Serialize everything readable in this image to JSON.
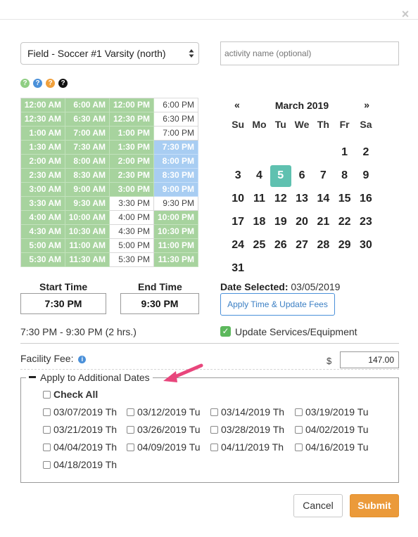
{
  "dialog": {
    "close_glyph": "×",
    "close_icon": "close-icon"
  },
  "form": {
    "facility_value": "Field - Soccer #1 Varsity (north)",
    "activity_placeholder": "activity name (optional)",
    "activity_value": ""
  },
  "help_icons": [
    {
      "name": "help-icon-green",
      "glyph": "?",
      "color": "#8fce83"
    },
    {
      "name": "help-icon-blue",
      "glyph": "?",
      "color": "#4a90d9"
    },
    {
      "name": "help-icon-orange",
      "glyph": "?",
      "color": "#f0a03c"
    },
    {
      "name": "help-icon-black",
      "glyph": "?",
      "color": "#111111"
    }
  ],
  "time_slots": {
    "columns": [
      [
        {
          "t": "12:00 AM",
          "s": "booked"
        },
        {
          "t": "12:30 AM",
          "s": "booked"
        },
        {
          "t": "1:00 AM",
          "s": "booked"
        },
        {
          "t": "1:30 AM",
          "s": "booked"
        },
        {
          "t": "2:00 AM",
          "s": "booked"
        },
        {
          "t": "2:30 AM",
          "s": "booked"
        },
        {
          "t": "3:00 AM",
          "s": "booked"
        },
        {
          "t": "3:30 AM",
          "s": "booked"
        },
        {
          "t": "4:00 AM",
          "s": "booked"
        },
        {
          "t": "4:30 AM",
          "s": "booked"
        },
        {
          "t": "5:00 AM",
          "s": "booked"
        },
        {
          "t": "5:30 AM",
          "s": "booked"
        }
      ],
      [
        {
          "t": "6:00 AM",
          "s": "booked"
        },
        {
          "t": "6:30 AM",
          "s": "booked"
        },
        {
          "t": "7:00 AM",
          "s": "booked"
        },
        {
          "t": "7:30 AM",
          "s": "booked"
        },
        {
          "t": "8:00 AM",
          "s": "booked"
        },
        {
          "t": "8:30 AM",
          "s": "booked"
        },
        {
          "t": "9:00 AM",
          "s": "booked"
        },
        {
          "t": "9:30 AM",
          "s": "booked"
        },
        {
          "t": "10:00 AM",
          "s": "booked"
        },
        {
          "t": "10:30 AM",
          "s": "booked"
        },
        {
          "t": "11:00 AM",
          "s": "booked"
        },
        {
          "t": "11:30 AM",
          "s": "booked"
        }
      ],
      [
        {
          "t": "12:00 PM",
          "s": "booked"
        },
        {
          "t": "12:30 PM",
          "s": "booked"
        },
        {
          "t": "1:00 PM",
          "s": "booked"
        },
        {
          "t": "1:30 PM",
          "s": "booked"
        },
        {
          "t": "2:00 PM",
          "s": "booked"
        },
        {
          "t": "2:30 PM",
          "s": "booked"
        },
        {
          "t": "3:00 PM",
          "s": "booked"
        },
        {
          "t": "3:30 PM",
          "s": "free"
        },
        {
          "t": "4:00 PM",
          "s": "free"
        },
        {
          "t": "4:30 PM",
          "s": "free"
        },
        {
          "t": "5:00 PM",
          "s": "free"
        },
        {
          "t": "5:30 PM",
          "s": "free"
        }
      ],
      [
        {
          "t": "6:00 PM",
          "s": "free"
        },
        {
          "t": "6:30 PM",
          "s": "free"
        },
        {
          "t": "7:00 PM",
          "s": "free"
        },
        {
          "t": "7:30 PM",
          "s": "selected"
        },
        {
          "t": "8:00 PM",
          "s": "selected"
        },
        {
          "t": "8:30 PM",
          "s": "selected"
        },
        {
          "t": "9:00 PM",
          "s": "selected"
        },
        {
          "t": "9:30 PM",
          "s": "free"
        },
        {
          "t": "10:00 PM",
          "s": "booked"
        },
        {
          "t": "10:30 PM",
          "s": "booked"
        },
        {
          "t": "11:00 PM",
          "s": "booked"
        },
        {
          "t": "11:30 PM",
          "s": "booked"
        }
      ]
    ],
    "colors": {
      "booked": "#a7d39e",
      "selected": "#a8cdf2",
      "free": "#ffffff"
    }
  },
  "calendar": {
    "prev": "«",
    "next": "»",
    "title": "March 2019",
    "weekdays": [
      "Su",
      "Mo",
      "Tu",
      "We",
      "Th",
      "Fr",
      "Sa"
    ],
    "leading_blanks": 5,
    "days": [
      "1",
      "2",
      "3",
      "4",
      "5",
      "6",
      "7",
      "8",
      "9",
      "10",
      "11",
      "12",
      "13",
      "14",
      "15",
      "16",
      "17",
      "18",
      "19",
      "20",
      "21",
      "22",
      "23",
      "24",
      "25",
      "26",
      "27",
      "28",
      "29",
      "30",
      "31"
    ],
    "selected_day": "5",
    "selected_color": "#5fc1b0"
  },
  "times": {
    "start_label": "Start Time",
    "start_value": "7:30 PM",
    "end_label": "End Time",
    "end_value": "9:30 PM",
    "date_selected_label": "Date Selected:",
    "date_selected_value": "03/05/2019",
    "apply_button": "Apply Time & Update Fees",
    "range_text": "7:30 PM - 9:30 PM (2 hrs.)",
    "update_services_label": "Update Services/Equipment",
    "update_services_checked": true
  },
  "fees": {
    "facility_fee_label": "Facility Fee:",
    "currency": "$",
    "facility_fee_value": "147.00"
  },
  "additional_dates": {
    "legend": "Apply to Additional Dates",
    "check_all": "Check All",
    "dates": [
      "03/07/2019 Th",
      "03/12/2019 Tu",
      "03/14/2019 Th",
      "03/19/2019 Tu",
      "03/21/2019 Th",
      "03/26/2019 Tu",
      "03/28/2019 Th",
      "04/02/2019 Tu",
      "04/04/2019 Th",
      "04/09/2019 Tu",
      "04/11/2019 Th",
      "04/16/2019 Tu",
      "04/18/2019 Th"
    ]
  },
  "annotation": {
    "arrow_color": "#e8467c"
  },
  "footer": {
    "cancel": "Cancel",
    "submit": "Submit",
    "submit_color": "#eb9a3a"
  }
}
